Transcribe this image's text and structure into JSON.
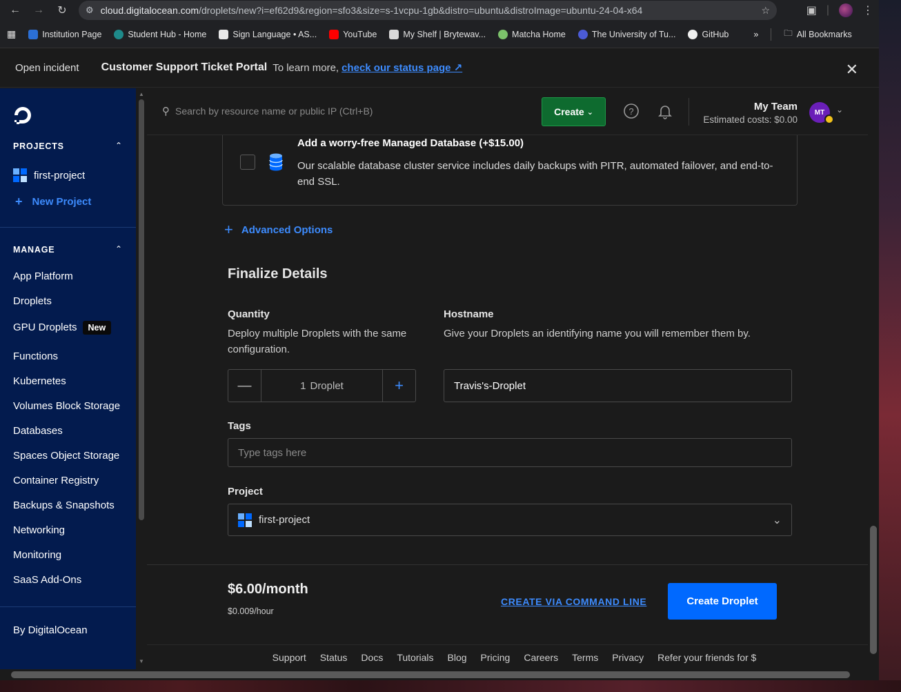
{
  "browser": {
    "url_host": "cloud.digitalocean.com",
    "url_path": "/droplets/new?i=ef62d9&region=sfo3&size=s-1vcpu-1gb&distro=ubuntu&distroImage=ubuntu-24-04-x64",
    "bookmarks": [
      {
        "label": "Institution Page",
        "color": "#2b6fd6"
      },
      {
        "label": "Student Hub - Home",
        "color": "#1e8a8a"
      },
      {
        "label": "Sign Language • AS...",
        "color": "#e8e8e8"
      },
      {
        "label": "YouTube",
        "color": "#ff0000"
      },
      {
        "label": "My Shelf | Brytewav...",
        "color": "#d9d9d9"
      },
      {
        "label": "Matcha Home",
        "color": "#7cc26b"
      },
      {
        "label": "The University of Tu...",
        "color": "#4b5bd6"
      },
      {
        "label": "GitHub",
        "color": "#f0f0f0"
      }
    ],
    "more": "»",
    "all_bookmarks": "All Bookmarks"
  },
  "banner": {
    "incident": "Open incident",
    "portal": "Customer Support Ticket Portal",
    "learn": "To learn more,",
    "link": "check our status page ↗"
  },
  "sidebar": {
    "projects_title": "PROJECTS",
    "project_name": "first-project",
    "new_project": "New Project",
    "manage_title": "MANAGE",
    "items": [
      "App Platform",
      "Droplets",
      "GPU Droplets",
      "Functions",
      "Kubernetes",
      "Volumes Block Storage",
      "Databases",
      "Spaces Object Storage",
      "Container Registry",
      "Backups & Snapshots",
      "Networking",
      "Monitoring",
      "SaaS Add-Ons"
    ],
    "gpu_badge": "New",
    "by": "By DigitalOcean"
  },
  "topbar": {
    "search_placeholder": "Search by resource name or public IP (Ctrl+B)",
    "create": "Create",
    "team_name": "My Team",
    "estimated_costs": "Estimated costs: $0.00",
    "avatar_initials": "MT"
  },
  "database": {
    "title": "Add a worry-free Managed Database (+$15.00)",
    "description": "Our scalable database cluster service includes daily backups with PITR, automated failover, and end-to-end SSL."
  },
  "advanced_options": "Advanced Options",
  "finalize": {
    "title": "Finalize Details",
    "quantity_label": "Quantity",
    "quantity_desc": "Deploy multiple Droplets with the same configuration.",
    "quantity_value": "1",
    "quantity_unit": "Droplet",
    "hostname_label": "Hostname",
    "hostname_desc": "Give your Droplets an identifying name you will remember them by.",
    "hostname_value": "Travis's-Droplet",
    "tags_label": "Tags",
    "tags_placeholder": "Type tags here",
    "project_label": "Project",
    "project_value": "first-project"
  },
  "summary": {
    "price": "$6.00/month",
    "hourly": "$0.009/hour",
    "cli": "CREATE VIA COMMAND LINE",
    "create": "Create Droplet"
  },
  "footer": [
    "Support",
    "Status",
    "Docs",
    "Tutorials",
    "Blog",
    "Pricing",
    "Careers",
    "Terms",
    "Privacy",
    "Refer your friends for $"
  ]
}
